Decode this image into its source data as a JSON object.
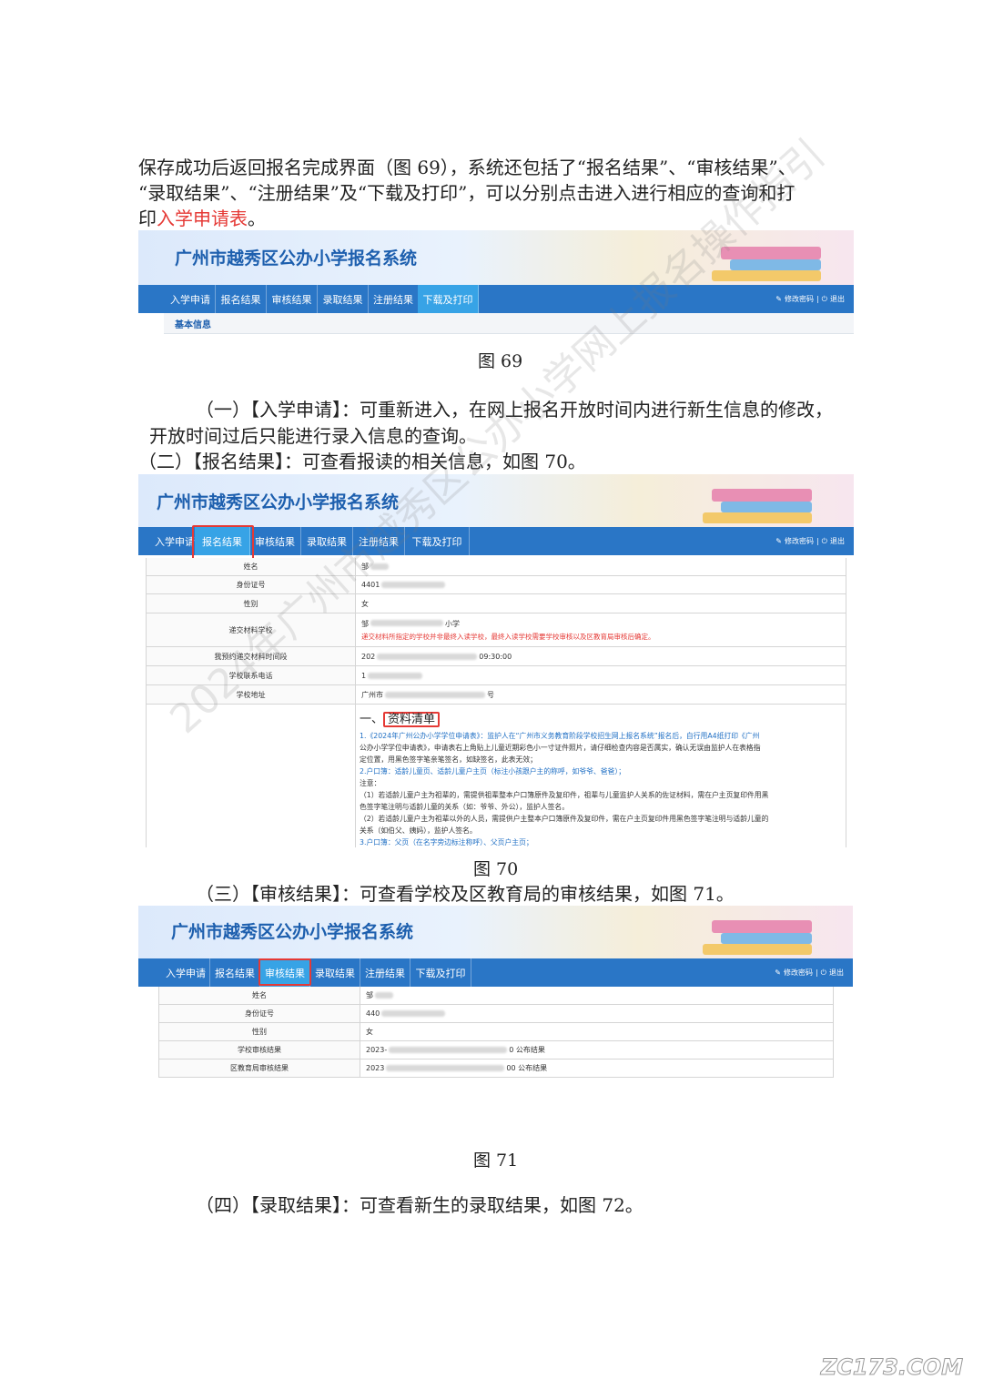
{
  "para_intro": {
    "line1": "保存成功后返回报名完成界面（图 69），系统还包括了“报名结果”、“审核结果”、",
    "line2": "“录取结果”、“注册结果”及“下载及打印”，可以分别点击进入进行相应的查询和打",
    "line3_prefix": "印",
    "line3_link": "入学申请表",
    "line3_suffix": "。"
  },
  "system_title": "广州市越秀区公办小学报名系统",
  "nav_items": [
    "入学申请",
    "报名结果",
    "审核结果",
    "录取结果",
    "注册结果",
    "下载及打印"
  ],
  "nav_right": {
    "edit_pwd": "修改密码",
    "sep": "|",
    "logout": "退出"
  },
  "fig69": {
    "section_label": "基本信息",
    "caption": "图 69"
  },
  "para_apply": {
    "line1": "（一）【入学申请】：可重新进入，在网上报名开放时间内进行新生信息的修改，",
    "line2": "开放时间过后只能进行录入信息的查询。"
  },
  "para_result": "（二）【报名结果】：可查看报读的相关信息，如图 70。",
  "fig70": {
    "rows": [
      {
        "label": "姓名",
        "value": "​邹"
      },
      {
        "label": "身份证号",
        "value": "4401"
      },
      {
        "label": "性别",
        "value": "女"
      },
      {
        "label": "递交材料学校",
        "value": "邹",
        "value2": "小学",
        "notice": "递交材料所指定的学校并非最终入读学校，最终入读学校需要学校审核以及区教育局审核后确定。"
      },
      {
        "label": "我预约递交材料时间段",
        "value": "202",
        "value2": "09:30:00"
      },
      {
        "label": "学校联系电话",
        "value": "1"
      },
      {
        "label": "学校地址",
        "value": "广州市",
        "value2": "号"
      }
    ],
    "list_title_prefix": "一、",
    "list_title": "资料清单",
    "list_lines": [
      "1.《2024年广州公办小学学位申请表》：监护人在“广州市义务教育阶段学校招生网上报名系统”报名后，自行用A4纸打印《广州",
      "公办小学学位申请表》，申请表右上角贴上儿童近期彩色小一寸证件照片，请仔细检查内容是否属实，确认无误由监护人在表格指",
      "定位置，用黑色签字笔亲笔签名，如缺签名，此表无效；",
      "2.户口簿：适龄儿童页、适龄儿童户主页（标注小孩跟户主的称呼，如爷爷、爸爸）；",
      "注意：",
      "（1）若适龄儿童户主为祖辈的，需提供祖辈整本户口簿原件及复印件，祖辈与儿童监护人关系的佐证材料，需在户主页复印件用黑",
      "色签字笔注明与适龄儿童的关系（如：爷爷、外公），监护人签名。",
      "（2）若适龄儿童户主为祖辈以外的人员，需提供户主整本户口簿原件及复印件，需在户主页复印件用黑色签字笔注明与适龄儿童的",
      "关系（如伯父、姨妈），监护人签名。",
      "3.户口簿：父页（在名字旁边标注称呼）、父页户主页；"
    ],
    "caption": "图 70"
  },
  "para_review": "（三）【审核结果】：可查看学校及区教育局的审核结果，如图 71。",
  "fig71": {
    "rows": [
      {
        "label": "姓名",
        "value": "邹"
      },
      {
        "label": "身份证号",
        "value": "440"
      },
      {
        "label": "性别",
        "value": "女"
      },
      {
        "label": "学校审核结果",
        "value": "2023-",
        "value2": "0 公布结果"
      },
      {
        "label": "区教育局审核结果",
        "value": "2023",
        "value2": "00 公布结果"
      }
    ],
    "caption": "图 71"
  },
  "para_admit": "（四）【录取结果】：可查看新生的录取结果，如图 72。",
  "watermark": "2024年广州市越秀区公办小学网上报名操作指引",
  "site_logo": "ZC173.COM",
  "colors": {
    "nav": "#2a76c6",
    "nav_active": "#37a3e6",
    "title": "#1d5fae",
    "highlight": "#e53935",
    "link_red": "#e53935",
    "list_blue": "#1f6fc4"
  }
}
